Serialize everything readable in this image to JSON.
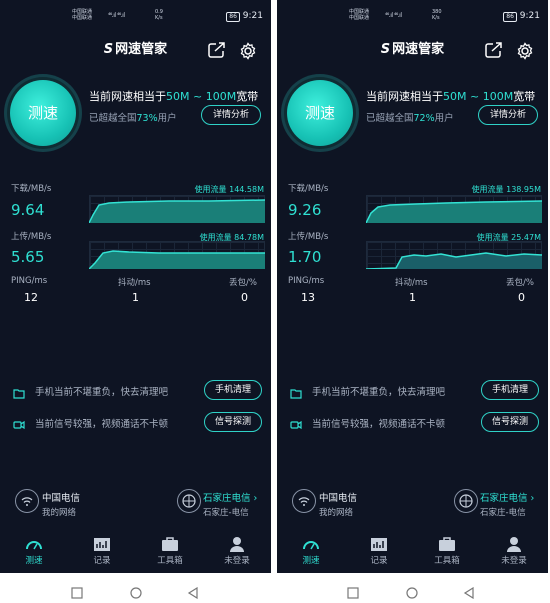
{
  "screens": [
    {
      "status": {
        "carrier1": "中国联通",
        "carrier2": "中国联通",
        "signal": "⁴⁶.ıl ⁴⁶.ıl",
        "speed_value": "0.9",
        "speed_unit": "K/s",
        "battery": "86",
        "time": "9:21"
      },
      "app_title": "网速管家",
      "test_button": "测速",
      "headline_prefix": "当前网速相当于",
      "headline_range": "50M ~ 100M",
      "headline_suffix": "宽带",
      "beat_prefix": "已超越全国",
      "beat_pct": "73%",
      "beat_suffix": "用户",
      "detail_button": "详情分析",
      "download_label": "下载/MB/s",
      "download_value": "9.64",
      "download_usage": "使用流量 144.58M",
      "upload_label": "上传/MB/s",
      "upload_value": "5.65",
      "upload_usage": "使用流量 84.78M",
      "ping_label": "PING/ms",
      "ping_value": "12",
      "jitter_label": "抖动/ms",
      "jitter_value": "1",
      "loss_label": "丢包/%",
      "loss_value": "0",
      "tip1_text": "手机当前不堪重负，快去清理吧",
      "tip1_button": "手机清理",
      "tip2_text": "当前信号较强，视频通话不卡顿",
      "tip2_button": "信号探测",
      "network_name": "中国电信",
      "network_sub": "我的网络",
      "location_name": "石家庄电信 ›",
      "location_sub": "石家庄-电信",
      "tabs": [
        "测速",
        "记录",
        "工具箱",
        "未登录"
      ]
    },
    {
      "status": {
        "carrier1": "中国联通",
        "carrier2": "中国联通",
        "signal": "⁴⁶.ıl ⁴⁶.ıl",
        "speed_value": "380",
        "speed_unit": "K/s",
        "battery": "86",
        "time": "9:21"
      },
      "app_title": "网速管家",
      "test_button": "测速",
      "headline_prefix": "当前网速相当于",
      "headline_range": "50M ~ 100M",
      "headline_suffix": "宽带",
      "beat_prefix": "已超越全国",
      "beat_pct": "72%",
      "beat_suffix": "用户",
      "detail_button": "详情分析",
      "download_label": "下载/MB/s",
      "download_value": "9.26",
      "download_usage": "使用流量 138.95M",
      "upload_label": "上传/MB/s",
      "upload_value": "1.70",
      "upload_usage": "使用流量 25.47M",
      "ping_label": "PING/ms",
      "ping_value": "13",
      "jitter_label": "抖动/ms",
      "jitter_value": "1",
      "loss_label": "丢包/%",
      "loss_value": "0",
      "tip1_text": "手机当前不堪重负，快去清理吧",
      "tip1_button": "手机清理",
      "tip2_text": "当前信号较强，视频通话不卡顿",
      "tip2_button": "信号探测",
      "network_name": "中国电信",
      "network_sub": "我的网络",
      "location_name": "石家庄电信 ›",
      "location_sub": "石家庄-电信",
      "tabs": [
        "测速",
        "记录",
        "工具箱",
        "未登录"
      ]
    }
  ],
  "colors": {
    "background": "#0e1423",
    "accent": "#2fe0d2",
    "text_secondary": "#aab3c3"
  },
  "icons": [
    "share-icon",
    "gear-icon",
    "phone-clean-icon",
    "signal-probe-icon",
    "wifi-icon",
    "location-icon",
    "speedometer-icon",
    "chart-icon",
    "toolbox-icon",
    "user-icon"
  ]
}
